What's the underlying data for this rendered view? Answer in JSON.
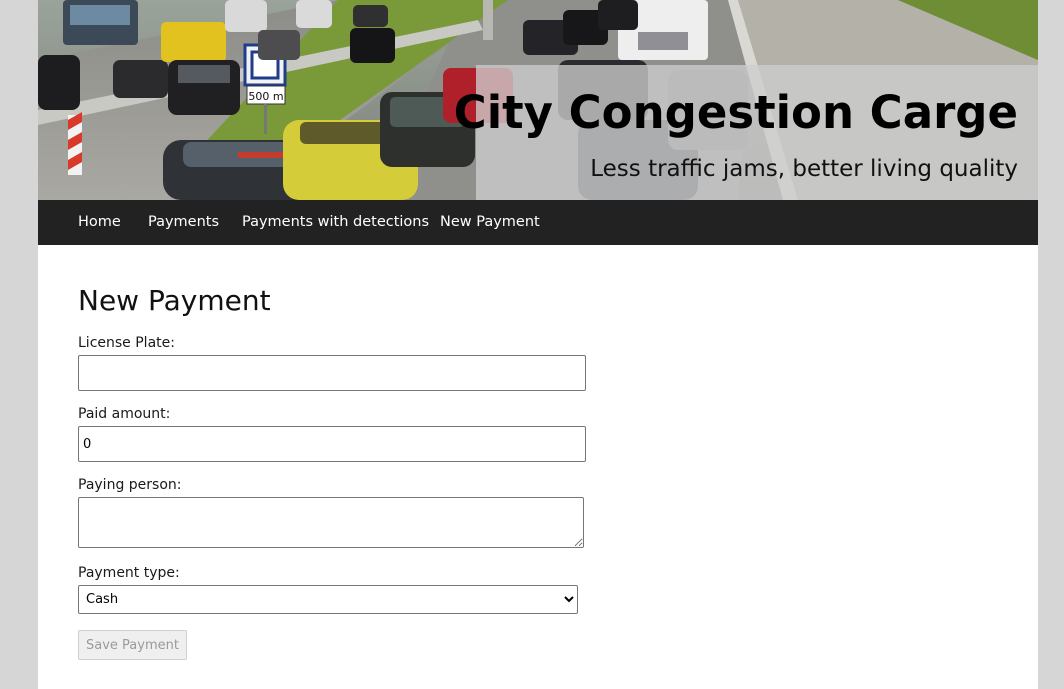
{
  "header": {
    "title": "City Congestion Carge",
    "tagline": "Less traffic jams, better living quality",
    "road_sign_distance": "500 m"
  },
  "nav": {
    "items": [
      {
        "label": "Home"
      },
      {
        "label": "Payments"
      },
      {
        "label": "Payments with detections"
      },
      {
        "label": "New Payment"
      }
    ]
  },
  "form": {
    "heading": "New Payment",
    "license_plate": {
      "label": "License Plate:",
      "value": ""
    },
    "paid_amount": {
      "label": "Paid amount:",
      "value": "0"
    },
    "paying_person": {
      "label": "Paying person:",
      "value": ""
    },
    "payment_type": {
      "label": "Payment type:",
      "selected": "Cash"
    },
    "save_label": "Save Payment"
  },
  "colors": {
    "page_background": "#d6d6d6",
    "nav_background": "#222222",
    "nav_text": "#ffffff",
    "overlay": "#cdcdcd"
  }
}
